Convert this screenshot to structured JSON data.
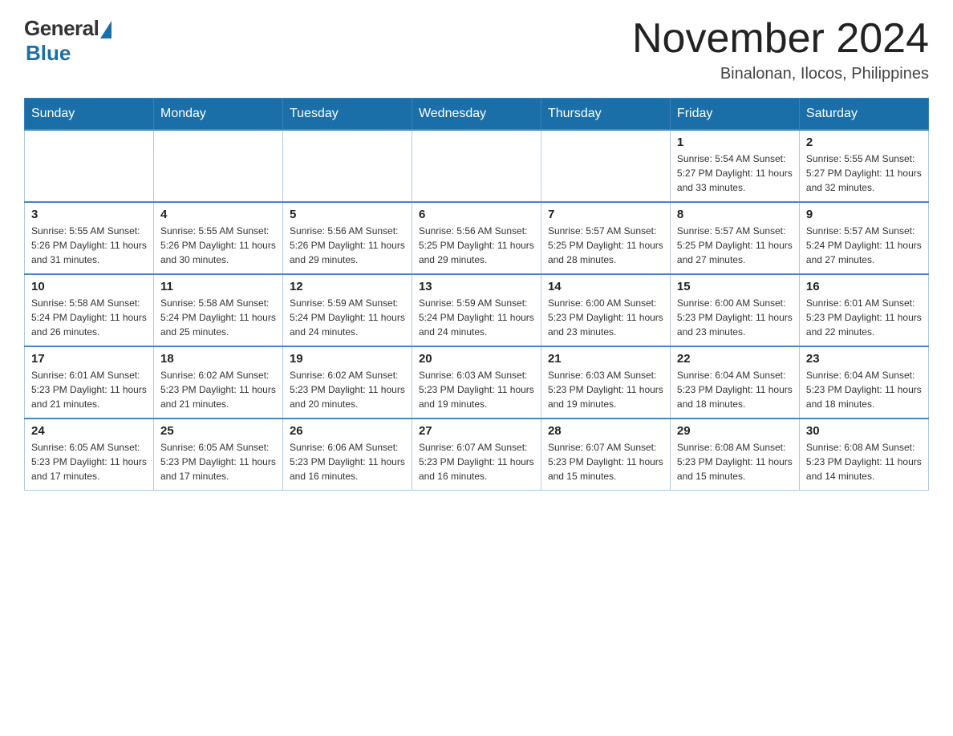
{
  "header": {
    "logo_general": "General",
    "logo_blue": "Blue",
    "month_title": "November 2024",
    "location": "Binalonan, Ilocos, Philippines"
  },
  "days_of_week": [
    "Sunday",
    "Monday",
    "Tuesday",
    "Wednesday",
    "Thursday",
    "Friday",
    "Saturday"
  ],
  "weeks": [
    [
      {
        "day": "",
        "info": ""
      },
      {
        "day": "",
        "info": ""
      },
      {
        "day": "",
        "info": ""
      },
      {
        "day": "",
        "info": ""
      },
      {
        "day": "",
        "info": ""
      },
      {
        "day": "1",
        "info": "Sunrise: 5:54 AM\nSunset: 5:27 PM\nDaylight: 11 hours and 33 minutes."
      },
      {
        "day": "2",
        "info": "Sunrise: 5:55 AM\nSunset: 5:27 PM\nDaylight: 11 hours and 32 minutes."
      }
    ],
    [
      {
        "day": "3",
        "info": "Sunrise: 5:55 AM\nSunset: 5:26 PM\nDaylight: 11 hours and 31 minutes."
      },
      {
        "day": "4",
        "info": "Sunrise: 5:55 AM\nSunset: 5:26 PM\nDaylight: 11 hours and 30 minutes."
      },
      {
        "day": "5",
        "info": "Sunrise: 5:56 AM\nSunset: 5:26 PM\nDaylight: 11 hours and 29 minutes."
      },
      {
        "day": "6",
        "info": "Sunrise: 5:56 AM\nSunset: 5:25 PM\nDaylight: 11 hours and 29 minutes."
      },
      {
        "day": "7",
        "info": "Sunrise: 5:57 AM\nSunset: 5:25 PM\nDaylight: 11 hours and 28 minutes."
      },
      {
        "day": "8",
        "info": "Sunrise: 5:57 AM\nSunset: 5:25 PM\nDaylight: 11 hours and 27 minutes."
      },
      {
        "day": "9",
        "info": "Sunrise: 5:57 AM\nSunset: 5:24 PM\nDaylight: 11 hours and 27 minutes."
      }
    ],
    [
      {
        "day": "10",
        "info": "Sunrise: 5:58 AM\nSunset: 5:24 PM\nDaylight: 11 hours and 26 minutes."
      },
      {
        "day": "11",
        "info": "Sunrise: 5:58 AM\nSunset: 5:24 PM\nDaylight: 11 hours and 25 minutes."
      },
      {
        "day": "12",
        "info": "Sunrise: 5:59 AM\nSunset: 5:24 PM\nDaylight: 11 hours and 24 minutes."
      },
      {
        "day": "13",
        "info": "Sunrise: 5:59 AM\nSunset: 5:24 PM\nDaylight: 11 hours and 24 minutes."
      },
      {
        "day": "14",
        "info": "Sunrise: 6:00 AM\nSunset: 5:23 PM\nDaylight: 11 hours and 23 minutes."
      },
      {
        "day": "15",
        "info": "Sunrise: 6:00 AM\nSunset: 5:23 PM\nDaylight: 11 hours and 23 minutes."
      },
      {
        "day": "16",
        "info": "Sunrise: 6:01 AM\nSunset: 5:23 PM\nDaylight: 11 hours and 22 minutes."
      }
    ],
    [
      {
        "day": "17",
        "info": "Sunrise: 6:01 AM\nSunset: 5:23 PM\nDaylight: 11 hours and 21 minutes."
      },
      {
        "day": "18",
        "info": "Sunrise: 6:02 AM\nSunset: 5:23 PM\nDaylight: 11 hours and 21 minutes."
      },
      {
        "day": "19",
        "info": "Sunrise: 6:02 AM\nSunset: 5:23 PM\nDaylight: 11 hours and 20 minutes."
      },
      {
        "day": "20",
        "info": "Sunrise: 6:03 AM\nSunset: 5:23 PM\nDaylight: 11 hours and 19 minutes."
      },
      {
        "day": "21",
        "info": "Sunrise: 6:03 AM\nSunset: 5:23 PM\nDaylight: 11 hours and 19 minutes."
      },
      {
        "day": "22",
        "info": "Sunrise: 6:04 AM\nSunset: 5:23 PM\nDaylight: 11 hours and 18 minutes."
      },
      {
        "day": "23",
        "info": "Sunrise: 6:04 AM\nSunset: 5:23 PM\nDaylight: 11 hours and 18 minutes."
      }
    ],
    [
      {
        "day": "24",
        "info": "Sunrise: 6:05 AM\nSunset: 5:23 PM\nDaylight: 11 hours and 17 minutes."
      },
      {
        "day": "25",
        "info": "Sunrise: 6:05 AM\nSunset: 5:23 PM\nDaylight: 11 hours and 17 minutes."
      },
      {
        "day": "26",
        "info": "Sunrise: 6:06 AM\nSunset: 5:23 PM\nDaylight: 11 hours and 16 minutes."
      },
      {
        "day": "27",
        "info": "Sunrise: 6:07 AM\nSunset: 5:23 PM\nDaylight: 11 hours and 16 minutes."
      },
      {
        "day": "28",
        "info": "Sunrise: 6:07 AM\nSunset: 5:23 PM\nDaylight: 11 hours and 15 minutes."
      },
      {
        "day": "29",
        "info": "Sunrise: 6:08 AM\nSunset: 5:23 PM\nDaylight: 11 hours and 15 minutes."
      },
      {
        "day": "30",
        "info": "Sunrise: 6:08 AM\nSunset: 5:23 PM\nDaylight: 11 hours and 14 minutes."
      }
    ]
  ]
}
